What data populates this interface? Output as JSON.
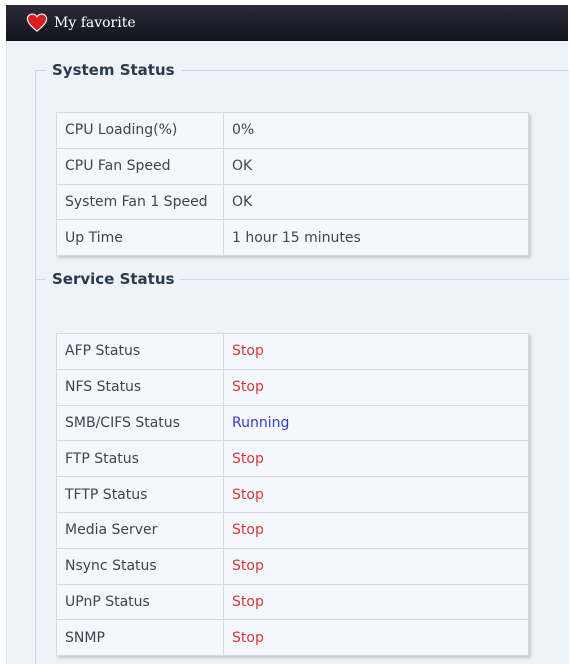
{
  "titlebar": {
    "title": "My favorite"
  },
  "system_status": {
    "legend": "System Status",
    "rows": [
      {
        "label": "CPU Loading(%)",
        "value": "0%"
      },
      {
        "label": "CPU Fan Speed",
        "value": "OK"
      },
      {
        "label": "System Fan 1 Speed",
        "value": "OK"
      },
      {
        "label": "Up Time",
        "value": "1 hour 15 minutes"
      }
    ]
  },
  "service_status": {
    "legend": "Service Status",
    "rows": [
      {
        "label": "AFP Status",
        "value": "Stop"
      },
      {
        "label": "NFS Status",
        "value": "Stop"
      },
      {
        "label": "SMB/CIFS Status",
        "value": "Running"
      },
      {
        "label": "FTP Status",
        "value": "Stop"
      },
      {
        "label": "TFTP Status",
        "value": "Stop"
      },
      {
        "label": "Media Server",
        "value": "Stop"
      },
      {
        "label": "Nsync Status",
        "value": "Stop"
      },
      {
        "label": "UPnP Status",
        "value": "Stop"
      },
      {
        "label": "SNMP",
        "value": "Stop"
      }
    ]
  },
  "colors": {
    "stop": "#d43a3a",
    "running": "#3a3ac8",
    "titlebar": "#1a1b26"
  }
}
